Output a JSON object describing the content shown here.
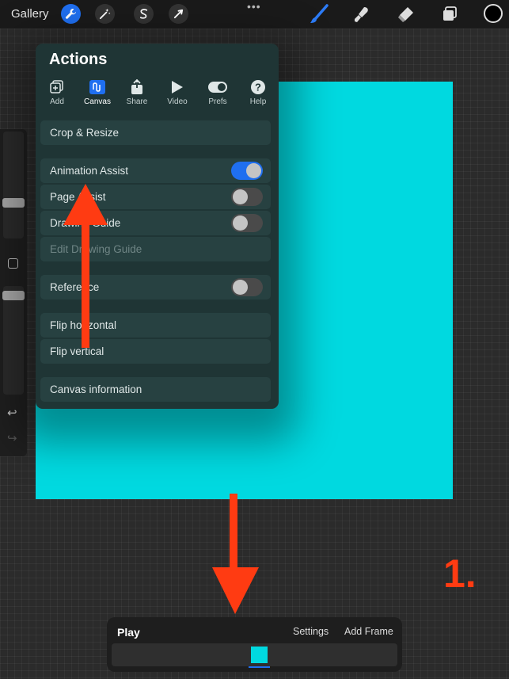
{
  "topbar": {
    "gallery_label": "Gallery",
    "tools_left": [
      "wrench-icon",
      "magic-wand-icon",
      "selection-icon",
      "transform-icon"
    ],
    "more_dots": "•••",
    "tools_right": [
      "brush-icon",
      "smudge-icon",
      "eraser-icon",
      "layers-icon"
    ],
    "current_color": "#000000"
  },
  "actions_panel": {
    "title": "Actions",
    "tabs": [
      {
        "label": "Add",
        "icon": "add-icon"
      },
      {
        "label": "Canvas",
        "icon": "canvas-icon",
        "active": true
      },
      {
        "label": "Share",
        "icon": "share-icon"
      },
      {
        "label": "Video",
        "icon": "video-icon"
      },
      {
        "label": "Prefs",
        "icon": "prefs-toggle-icon"
      },
      {
        "label": "Help",
        "icon": "help-icon"
      }
    ],
    "rows": {
      "crop_resize": "Crop & Resize",
      "animation_assist": "Animation Assist",
      "page_assist": "Page Assist",
      "drawing_guide": "Drawing Guide",
      "edit_drawing_guide": "Edit Drawing Guide",
      "reference": "Reference",
      "flip_horizontal": "Flip horizontal",
      "flip_vertical": "Flip vertical",
      "canvas_information": "Canvas information"
    },
    "toggles": {
      "animation_assist": true,
      "page_assist": false,
      "drawing_guide": false,
      "reference": false
    }
  },
  "timeline": {
    "play_label": "Play",
    "settings_label": "Settings",
    "add_frame_label": "Add Frame"
  },
  "annotation": {
    "step_label": "1."
  },
  "colors": {
    "canvas": "#00d9e0",
    "accent": "#1f6ff0",
    "arrow": "#ff3b12",
    "panel": "#1f3535"
  }
}
